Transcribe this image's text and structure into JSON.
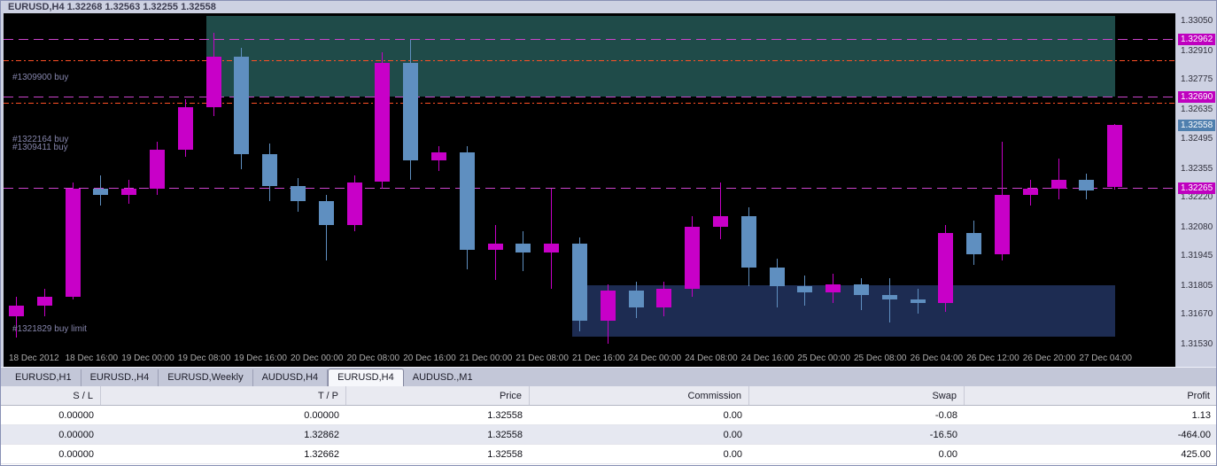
{
  "chart_data": {
    "type": "candlestick",
    "symbol": "EURUSD",
    "timeframe": "H4",
    "title_line": "EURUSD,H4  1.32268 1.32563 1.32255 1.32558",
    "current_bar": {
      "open": 1.32268,
      "high": 1.32563,
      "low": 1.32255,
      "close": 1.32558
    },
    "colors": {
      "background": "#000000",
      "bull_candle": "#c800c8",
      "bear_candle": "#5f8fc0",
      "level_line": "#cc44cc",
      "tp_line": "#ff5026",
      "supply_zone": "#1f4b49",
      "demand_zone": "#1d2c52",
      "tag_magenta": "#bf00bf",
      "tag_blue": "#4f7fae"
    },
    "price_axis": {
      "range": [
        1.3153,
        1.3305
      ],
      "ticks": [
        "1.33050",
        "1.32910",
        "1.32775",
        "1.32635",
        "1.32495",
        "1.32355",
        "1.32220",
        "1.32080",
        "1.31945",
        "1.31805",
        "1.31670",
        "1.31530"
      ],
      "tags": [
        {
          "price": "1.32962",
          "color": "#bf00bf"
        },
        {
          "price": "1.32690",
          "color": "#bf00bf"
        },
        {
          "price": "1.32558",
          "color": "#4f7fae"
        },
        {
          "price": "1.32265",
          "color": "#bf00bf"
        }
      ]
    },
    "time_labels": [
      {
        "i": 0,
        "label": "18 Dec 2012"
      },
      {
        "i": 2,
        "label": "18 Dec 16:00"
      },
      {
        "i": 4,
        "label": "19 Dec 00:00"
      },
      {
        "i": 6,
        "label": "19 Dec 08:00"
      },
      {
        "i": 8,
        "label": "19 Dec 16:00"
      },
      {
        "i": 10,
        "label": "20 Dec 00:00"
      },
      {
        "i": 12,
        "label": "20 Dec 08:00"
      },
      {
        "i": 14,
        "label": "20 Dec 16:00"
      },
      {
        "i": 16,
        "label": "21 Dec 00:00"
      },
      {
        "i": 18,
        "label": "21 Dec 08:00"
      },
      {
        "i": 20,
        "label": "21 Dec 16:00"
      },
      {
        "i": 22,
        "label": "24 Dec 00:00"
      },
      {
        "i": 24,
        "label": "24 Dec 08:00"
      },
      {
        "i": 26,
        "label": "24 Dec 16:00"
      },
      {
        "i": 28,
        "label": "25 Dec 00:00"
      },
      {
        "i": 30,
        "label": "25 Dec 08:00"
      },
      {
        "i": 32,
        "label": "26 Dec 04:00"
      },
      {
        "i": 34,
        "label": "26 Dec 12:00"
      },
      {
        "i": 36,
        "label": "26 Dec 20:00"
      },
      {
        "i": 38,
        "label": "27 Dec 04:00"
      }
    ],
    "candles": [
      {
        "o": 1.3166,
        "h": 1.3175,
        "l": 1.3156,
        "c": 1.3171,
        "d": "up"
      },
      {
        "o": 1.3171,
        "h": 1.3179,
        "l": 1.3166,
        "c": 1.3175,
        "d": "up"
      },
      {
        "o": 1.3175,
        "h": 1.3229,
        "l": 1.3174,
        "c": 1.3226,
        "d": "up"
      },
      {
        "o": 1.3226,
        "h": 1.3232,
        "l": 1.3218,
        "c": 1.3223,
        "d": "down"
      },
      {
        "o": 1.3223,
        "h": 1.323,
        "l": 1.3219,
        "c": 1.3226,
        "d": "up"
      },
      {
        "o": 1.3226,
        "h": 1.3248,
        "l": 1.3223,
        "c": 1.3244,
        "d": "up"
      },
      {
        "o": 1.3244,
        "h": 1.3268,
        "l": 1.3241,
        "c": 1.3264,
        "d": "up"
      },
      {
        "o": 1.3264,
        "h": 1.3299,
        "l": 1.326,
        "c": 1.3288,
        "d": "up"
      },
      {
        "o": 1.3288,
        "h": 1.3292,
        "l": 1.3235,
        "c": 1.3242,
        "d": "down"
      },
      {
        "o": 1.3242,
        "h": 1.3247,
        "l": 1.322,
        "c": 1.3227,
        "d": "down"
      },
      {
        "o": 1.3227,
        "h": 1.3231,
        "l": 1.3215,
        "c": 1.322,
        "d": "down"
      },
      {
        "o": 1.322,
        "h": 1.3223,
        "l": 1.3192,
        "c": 1.3209,
        "d": "down"
      },
      {
        "o": 1.3209,
        "h": 1.3232,
        "l": 1.3206,
        "c": 1.3229,
        "d": "up"
      },
      {
        "o": 1.3229,
        "h": 1.329,
        "l": 1.3226,
        "c": 1.3285,
        "d": "up"
      },
      {
        "o": 1.3285,
        "h": 1.3296,
        "l": 1.323,
        "c": 1.3239,
        "d": "down"
      },
      {
        "o": 1.3239,
        "h": 1.3246,
        "l": 1.3234,
        "c": 1.3243,
        "d": "up"
      },
      {
        "o": 1.3243,
        "h": 1.3246,
        "l": 1.3188,
        "c": 1.3197,
        "d": "down"
      },
      {
        "o": 1.3197,
        "h": 1.3209,
        "l": 1.3183,
        "c": 1.32,
        "d": "up"
      },
      {
        "o": 1.32,
        "h": 1.3206,
        "l": 1.3187,
        "c": 1.3196,
        "d": "down"
      },
      {
        "o": 1.3196,
        "h": 1.3226,
        "l": 1.3179,
        "c": 1.32,
        "d": "up"
      },
      {
        "o": 1.32,
        "h": 1.3203,
        "l": 1.3159,
        "c": 1.3164,
        "d": "down"
      },
      {
        "o": 1.3164,
        "h": 1.3181,
        "l": 1.3153,
        "c": 1.3178,
        "d": "up"
      },
      {
        "o": 1.3178,
        "h": 1.3182,
        "l": 1.3165,
        "c": 1.317,
        "d": "down"
      },
      {
        "o": 1.317,
        "h": 1.3182,
        "l": 1.3166,
        "c": 1.3179,
        "d": "up"
      },
      {
        "o": 1.3179,
        "h": 1.3213,
        "l": 1.3175,
        "c": 1.3208,
        "d": "up"
      },
      {
        "o": 1.3208,
        "h": 1.3229,
        "l": 1.3202,
        "c": 1.3213,
        "d": "up"
      },
      {
        "o": 1.3213,
        "h": 1.3217,
        "l": 1.318,
        "c": 1.3189,
        "d": "down"
      },
      {
        "o": 1.3189,
        "h": 1.3193,
        "l": 1.317,
        "c": 1.318,
        "d": "down"
      },
      {
        "o": 1.318,
        "h": 1.3185,
        "l": 1.3171,
        "c": 1.3177,
        "d": "down"
      },
      {
        "o": 1.3177,
        "h": 1.3186,
        "l": 1.3172,
        "c": 1.3181,
        "d": "up"
      },
      {
        "o": 1.3181,
        "h": 1.3184,
        "l": 1.3169,
        "c": 1.3176,
        "d": "down"
      },
      {
        "o": 1.3176,
        "h": 1.3184,
        "l": 1.3163,
        "c": 1.3174,
        "d": "down"
      },
      {
        "o": 1.3174,
        "h": 1.3179,
        "l": 1.3167,
        "c": 1.3172,
        "d": "down"
      },
      {
        "o": 1.3172,
        "h": 1.3209,
        "l": 1.3168,
        "c": 1.3205,
        "d": "up"
      },
      {
        "o": 1.3205,
        "h": 1.3211,
        "l": 1.319,
        "c": 1.3195,
        "d": "down"
      },
      {
        "o": 1.3195,
        "h": 1.3248,
        "l": 1.3192,
        "c": 1.3223,
        "d": "up"
      },
      {
        "o": 1.3223,
        "h": 1.323,
        "l": 1.3218,
        "c": 1.3226,
        "d": "up"
      },
      {
        "o": 1.3226,
        "h": 1.324,
        "l": 1.3221,
        "c": 1.323,
        "d": "up"
      },
      {
        "o": 1.323,
        "h": 1.3233,
        "l": 1.3221,
        "c": 1.3225,
        "d": "down"
      },
      {
        "o": 1.32268,
        "h": 1.32563,
        "l": 1.32255,
        "c": 1.32558,
        "d": "up"
      }
    ],
    "zones": [
      {
        "name": "supply-zone",
        "from_candle": 7,
        "to_candle": 39,
        "price_top": 1.3307,
        "price_bottom": 1.3269,
        "color": "#1f4b49"
      },
      {
        "name": "demand-zone",
        "from_candle": 20,
        "to_candle": 39,
        "price_top": 1.31805,
        "price_bottom": 1.31565,
        "color": "#1d2c52"
      }
    ],
    "hlines": [
      {
        "price": 1.32962,
        "style": "dashed",
        "color": "#cc44cc"
      },
      {
        "price": 1.3269,
        "style": "dashed",
        "color": "#cc44cc"
      },
      {
        "price": 1.32265,
        "style": "dashed",
        "color": "#cc44cc"
      },
      {
        "price": 1.32862,
        "style": "dashdot",
        "color": "#ff5026"
      },
      {
        "price": 1.32662,
        "style": "dashdot",
        "color": "#ff5026"
      }
    ],
    "order_labels": [
      {
        "text": "#1309900 buy",
        "price": 1.32785
      },
      {
        "text": "#1322164 buy",
        "price": 1.3249
      },
      {
        "text": "#1309411 buy",
        "price": 1.32455
      },
      {
        "text": "#1321829 buy limit",
        "price": 1.316
      }
    ]
  },
  "tabs": {
    "items": [
      "EURUSD,H1",
      "EURUSD.,H4",
      "EURUSD,Weekly",
      "AUDUSD,H4",
      "EURUSD,H4",
      "AUDUSD.,M1"
    ],
    "active_index": 4
  },
  "table": {
    "columns": [
      "S / L",
      "T / P",
      "Price",
      "Commission",
      "Swap",
      "Profit"
    ],
    "rows": [
      [
        "0.00000",
        "0.00000",
        "1.32558",
        "0.00",
        "-0.08",
        "1.13"
      ],
      [
        "0.00000",
        "1.32862",
        "1.32558",
        "0.00",
        "-16.50",
        "-464.00"
      ],
      [
        "0.00000",
        "1.32662",
        "1.32558",
        "0.00",
        "0.00",
        "425.00"
      ]
    ]
  }
}
